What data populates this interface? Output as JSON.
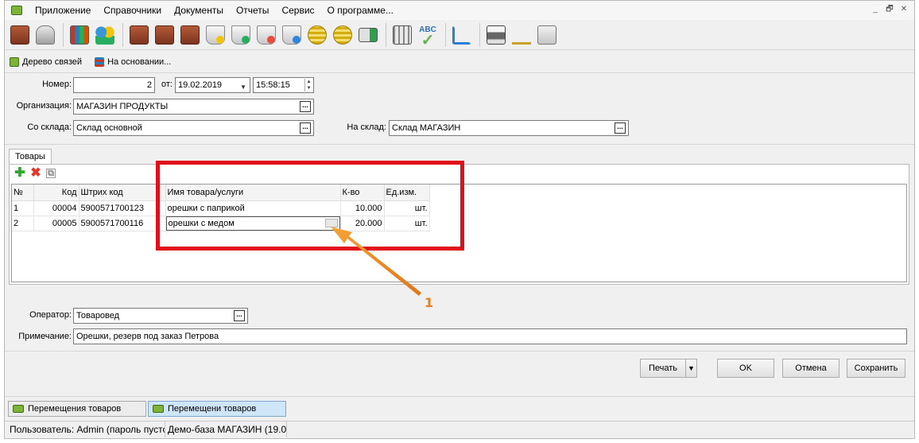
{
  "menu": [
    "Приложение",
    "Справочники",
    "Документы",
    "Отчеты",
    "Сервис",
    "О программе..."
  ],
  "window_controls": [
    "_",
    "🗗",
    "✕"
  ],
  "links": {
    "tree": "Дерево связей",
    "basis": "На основании..."
  },
  "form": {
    "number_label": "Номер:",
    "number_value": "2",
    "from_label": "от:",
    "date_value": "19.02.2019",
    "time_value": "15:58:15",
    "org_label": "Организация:",
    "org_value": "МАГАЗИН ПРОДУКТЫ",
    "from_store_label": "Со склада:",
    "from_store_value": "Склад основной",
    "to_store_label": "На склад:",
    "to_store_value": "Склад МАГАЗИН",
    "operator_label": "Оператор:",
    "operator_value": "Товаровед",
    "note_label": "Примечание:",
    "note_value": "Орешки, резерв под заказ Петрова"
  },
  "tabs": {
    "goods": "Товары"
  },
  "grid": {
    "columns": [
      "№",
      "Код",
      "Штрих код",
      "Имя товара/услуги",
      "К-во",
      "Ед.изм."
    ],
    "rows": [
      [
        "1",
        "00004",
        "5900571700123",
        "орешки с паприкой",
        "10.000",
        "шт."
      ],
      [
        "2",
        "00005",
        "5900571700116",
        "орешки с медом",
        "20.000",
        "шт."
      ]
    ]
  },
  "annotation": {
    "callout": "1"
  },
  "buttons": {
    "print": "Печать",
    "ok": "OK",
    "cancel": "Отмена",
    "save": "Сохранить"
  },
  "bottom_tabs": [
    "Перемещения товаров",
    "Перемещени товаров"
  ],
  "status": {
    "user": "Пользователь: Admin (пароль пусто",
    "db": "Демо-база МАГАЗИН (19.0"
  }
}
